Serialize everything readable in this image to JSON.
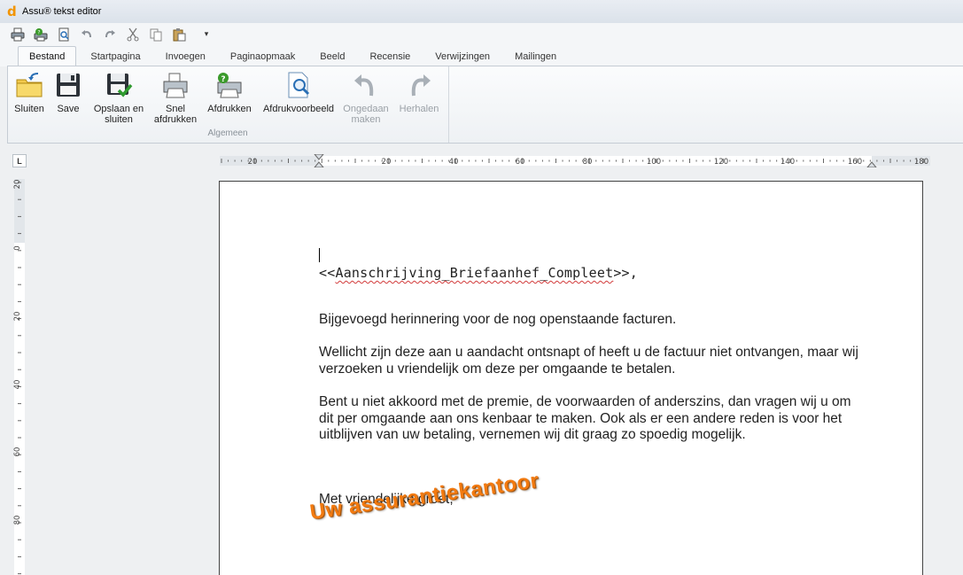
{
  "window": {
    "title": "Assu® tekst editor",
    "logo_glyph": "d"
  },
  "qat": {
    "buttons": [
      {
        "name": "print-icon"
      },
      {
        "name": "print-help-icon"
      },
      {
        "name": "print-preview-icon"
      },
      {
        "name": "undo-icon"
      },
      {
        "name": "redo-icon"
      },
      {
        "name": "cut-icon"
      },
      {
        "name": "copy-icon"
      },
      {
        "name": "paste-icon"
      }
    ],
    "dropdown_glyph": "▾"
  },
  "tabs": [
    {
      "label": "Bestand",
      "active": true
    },
    {
      "label": "Startpagina"
    },
    {
      "label": "Invoegen"
    },
    {
      "label": "Paginaopmaak"
    },
    {
      "label": "Beeld"
    },
    {
      "label": "Recensie"
    },
    {
      "label": "Verwijzingen"
    },
    {
      "label": "Mailingen"
    }
  ],
  "ribbon": {
    "group_label": "Algemeen",
    "buttons": [
      {
        "label": "Sluiten",
        "icon": "close-folder-icon"
      },
      {
        "label": "Save",
        "icon": "save-icon"
      },
      {
        "label": "Opslaan en\nsluiten",
        "icon": "save-close-icon"
      },
      {
        "label": "Snel\nafdrukken",
        "icon": "quick-print-icon"
      },
      {
        "label": "Afdrukken",
        "icon": "print-icon"
      },
      {
        "label": "Afdrukvoorbeeld",
        "icon": "print-preview-icon"
      },
      {
        "label": "Ongedaan\nmaken",
        "icon": "undo-icon",
        "disabled": true
      },
      {
        "label": "Herhalen",
        "icon": "redo-icon",
        "disabled": true
      }
    ]
  },
  "ruler": {
    "corner": "L",
    "h_labels": [
      "20",
      "20",
      "40",
      "60",
      "80",
      "100",
      "120",
      "140",
      "160",
      "180"
    ],
    "v_labels": [
      "20",
      "0",
      "20",
      "40",
      "60",
      "80"
    ]
  },
  "document": {
    "merge_prefix": "<<",
    "merge_field": "Aanschrijving_Briefaanhef_Compleet",
    "merge_suffix": ">>,",
    "p1": "Bijgevoegd herinnering voor de nog openstaande facturen.",
    "p2": "Wellicht zijn deze aan u aandacht ontsnapt of heeft u de factuur niet ontvangen, maar wij verzoeken u vriendelijk om deze per omgaande te betalen.",
    "p3": "Bent u niet akkoord met de premie, de voorwaarden of anderszins, dan vragen wij u om dit per omgaande aan ons kenbaar te maken. Ook als er een andere reden is voor het uitblijven van uw betaling, vernemen wij dit graag zo spoedig mogelijk.",
    "closing": "Met vriendelijke groet,",
    "signature": "Uw assurantiekantoor"
  },
  "colors": {
    "signature": "#f27a10",
    "accent": "#f29400"
  }
}
